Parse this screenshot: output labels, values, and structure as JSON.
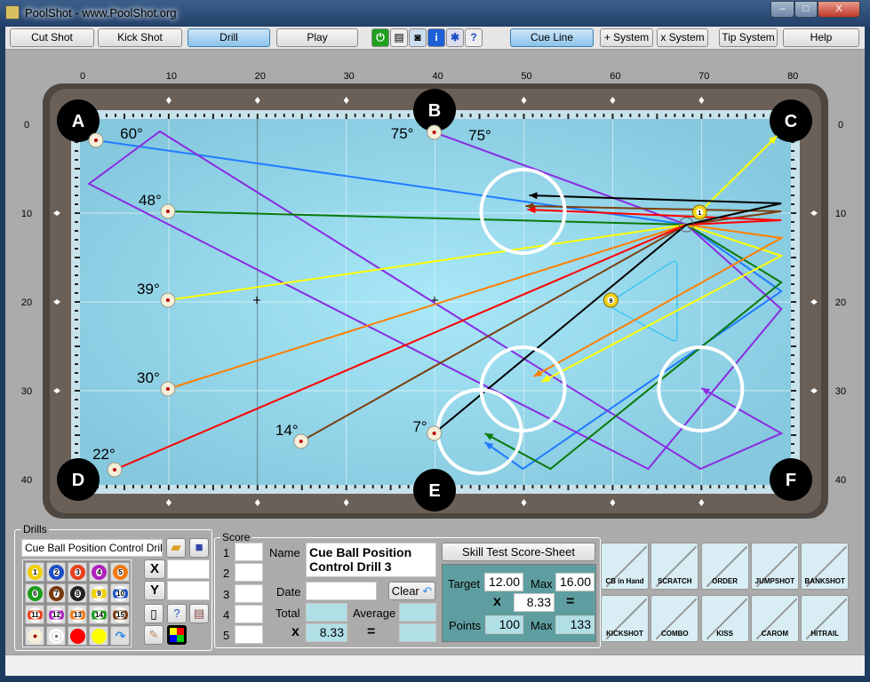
{
  "window": {
    "title": "PoolShot - www.PoolShot.org",
    "minimize": "–",
    "maximize": "□",
    "close": "X"
  },
  "toolbar": {
    "modes": [
      {
        "label": "Cut Shot",
        "active": false
      },
      {
        "label": "Kick Shot",
        "active": false
      },
      {
        "label": "Drill",
        "active": true
      },
      {
        "label": "Play",
        "active": false
      }
    ],
    "icons": [
      "power-icon",
      "print-icon",
      "camera-icon",
      "info-icon",
      "settings-icon",
      "help-document-icon"
    ],
    "options": [
      {
        "label": "Cue Line",
        "active": true
      },
      {
        "label": "+ System",
        "active": false
      },
      {
        "label": "x System",
        "active": false
      },
      {
        "label": "Tip System",
        "active": false
      },
      {
        "label": "Help",
        "active": false
      }
    ]
  },
  "table": {
    "x_ticks": [
      "0",
      "10",
      "20",
      "30",
      "40",
      "50",
      "60",
      "70",
      "80"
    ],
    "y_ticks": [
      "0",
      "10",
      "20",
      "30",
      "40"
    ],
    "pockets": [
      "A",
      "B",
      "C",
      "D",
      "E",
      "F"
    ],
    "colors": {
      "cloth": "#9edcf0",
      "rail": "#5a5048",
      "grid": "#e8f4f8"
    },
    "ghost_ball": [
      68.3,
      11.3
    ],
    "object_balls": [
      {
        "number": "1",
        "pos": [
          69.8,
          9.9
        ],
        "color": "#f2d21b",
        "path": [
          [
            69.8,
            9.9
          ],
          [
            78.5,
            1.3
          ]
        ],
        "path_color": "#ffff00"
      },
      {
        "number": "9",
        "pos": [
          59.8,
          19.8
        ],
        "color": "#f2d21b"
      }
    ],
    "rack_color": "#27c3f0",
    "target_circles": [
      [
        49.9,
        9.8
      ],
      [
        49.9,
        29.8
      ],
      [
        45,
        34.6
      ],
      [
        69.9,
        29.8
      ]
    ],
    "target_radius": 4.7,
    "shots": [
      {
        "angle": "60°",
        "color": "#1f7cff",
        "ball": [
          1.8,
          1.8
        ],
        "path": [
          [
            79,
            18.8
          ],
          [
            49.9,
            38.8
          ],
          [
            45.6,
            35.8
          ]
        ]
      },
      {
        "angle": "75°",
        "color": "#8a2be2",
        "ball": [
          39.9,
          0.9
        ],
        "path": [
          [
            79,
            20.8
          ],
          [
            64,
            38.8
          ],
          [
            1,
            6.7
          ],
          [
            9,
            0.8
          ],
          [
            69.9,
            38.8
          ],
          [
            79,
            34.8
          ],
          [
            70,
            29.7
          ]
        ]
      },
      {
        "angle": "48°",
        "color": "#0a7a0a",
        "ball": [
          9.9,
          9.8
        ],
        "path": [
          [
            79,
            17.8
          ],
          [
            53,
            38.8
          ],
          [
            45.6,
            34.8
          ]
        ]
      },
      {
        "angle": "39°",
        "color": "#ffff00",
        "ball": [
          9.9,
          19.8
        ],
        "path": [
          [
            79,
            14.8
          ],
          [
            52,
            29
          ]
        ]
      },
      {
        "angle": "30°",
        "color": "#ff7f00",
        "ball": [
          9.9,
          29.8
        ],
        "path": [
          [
            79,
            12.8
          ],
          [
            51.1,
            28.4
          ]
        ]
      },
      {
        "angle": "14°",
        "color": "#7b3f10",
        "ball": [
          24.9,
          35.7
        ],
        "path": [
          [
            79,
            9.8
          ],
          [
            50.2,
            9.2
          ]
        ]
      },
      {
        "angle": "22°",
        "color": "#ff0000",
        "ball": [
          3.9,
          38.9
        ],
        "path": [
          [
            79,
            10.8
          ],
          [
            50.4,
            9.6
          ]
        ]
      },
      {
        "angle": "7°",
        "color": "#000000",
        "ball": [
          39.9,
          34.8
        ],
        "path": [
          [
            79,
            8.9
          ],
          [
            50.6,
            8
          ]
        ]
      }
    ],
    "extra_label": "75°"
  },
  "drills": {
    "group_label": "Drills",
    "drill_name": "Cue Ball Position Control Drill 3",
    "balls": [
      {
        "n": "1",
        "c": "#f0d000"
      },
      {
        "n": "2",
        "c": "#1d4fc4"
      },
      {
        "n": "3",
        "c": "#e8401c"
      },
      {
        "n": "4",
        "c": "#b020c0"
      },
      {
        "n": "5",
        "c": "#f07a10"
      },
      {
        "n": "6",
        "c": "#1a9a1a"
      },
      {
        "n": "7",
        "c": "#7a3a10"
      },
      {
        "n": "8",
        "c": "#222222"
      },
      {
        "n": "9",
        "c": "#f0d000"
      },
      {
        "n": "10",
        "c": "#1d4fc4"
      },
      {
        "n": "11",
        "c": "#e8401c"
      },
      {
        "n": "12",
        "c": "#b020c0"
      },
      {
        "n": "13",
        "c": "#f07a10"
      },
      {
        "n": "14",
        "c": "#1a9a1a"
      },
      {
        "n": "15",
        "c": "#7a3a10"
      }
    ],
    "x_label": "X",
    "y_label": "Y",
    "x_value": "",
    "y_value": ""
  },
  "score": {
    "group_label": "Score",
    "rows": [
      "1",
      "2",
      "3",
      "4",
      "5"
    ],
    "name_label": "Name",
    "name_value": "Cue Ball Position Control Drill 3",
    "date_label": "Date",
    "date_value": "",
    "clear_label": "Clear",
    "total_label": "Total",
    "total_value": "",
    "average_label": "Average",
    "average_value": "",
    "x_label": "x",
    "multiplier": "8.33",
    "equals": "=",
    "result": ""
  },
  "skill": {
    "sheet_button": "Skill Test Score-Sheet",
    "target_label": "Target",
    "target": "12.00",
    "max_label": "Max",
    "max_target": "16.00",
    "x_label": "x",
    "multiplier": "8.33",
    "equals": "=",
    "points_label": "Points",
    "points": "100",
    "max_points": "133"
  },
  "shot_types": [
    "CB in Hand",
    "SCRATCH",
    "ORDER",
    "JUMPSHOT",
    "BANKSHOT",
    "KICKSHOT",
    "COMBO",
    "KISS",
    "CAROM",
    "HITRAIL"
  ],
  "status": ""
}
